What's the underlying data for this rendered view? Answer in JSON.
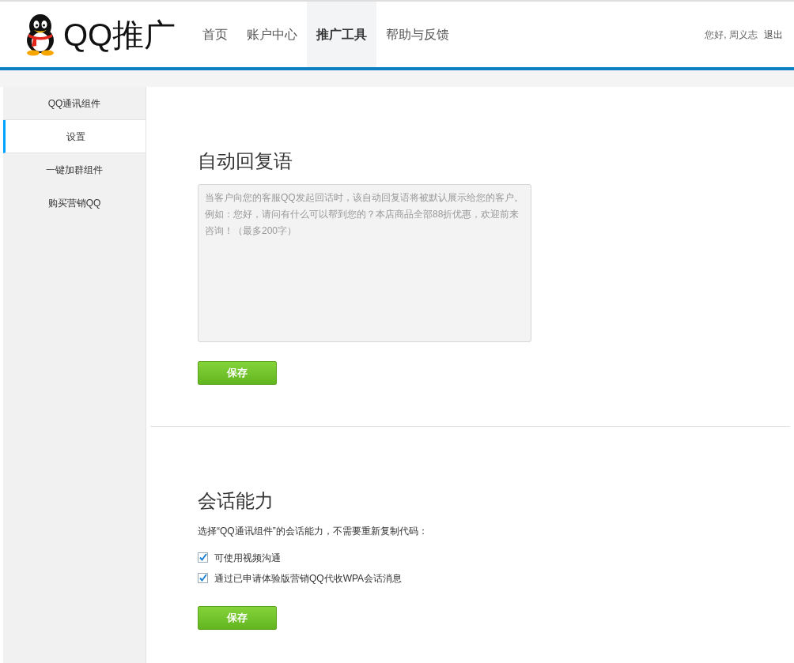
{
  "header": {
    "logo_text": "QQ推广",
    "nav": [
      {
        "label": "首页",
        "selected": false
      },
      {
        "label": "账户中心",
        "selected": false
      },
      {
        "label": "推广工具",
        "selected": true
      },
      {
        "label": "帮助与反馈",
        "selected": false
      }
    ],
    "greeting": "您好, 周义志",
    "logout": "退出"
  },
  "sidebar": {
    "items": [
      {
        "label": "QQ通讯组件",
        "selected": false
      },
      {
        "label": "设置",
        "selected": true
      },
      {
        "label": "一键加群组件",
        "selected": false
      },
      {
        "label": "购买营销QQ",
        "selected": false
      }
    ]
  },
  "auto_reply": {
    "title": "自动回复语",
    "placeholder": "当客户向您的客服QQ发起回话时，该自动回复语将被默认展示给您的客户。例如：您好，请问有什么可以帮到您的？本店商品全部88折优惠，欢迎前来咨询！（最多200字）",
    "save": "保存"
  },
  "session": {
    "title": "会话能力",
    "description": "选择“QQ通讯组件”的会话能力，不需要重新复制代码：",
    "options": [
      {
        "label": "可使用视频沟通",
        "checked": true
      },
      {
        "label": "通过已申请体验版营销QQ代收WPA会话消息",
        "checked": true
      }
    ],
    "save": "保存"
  }
}
